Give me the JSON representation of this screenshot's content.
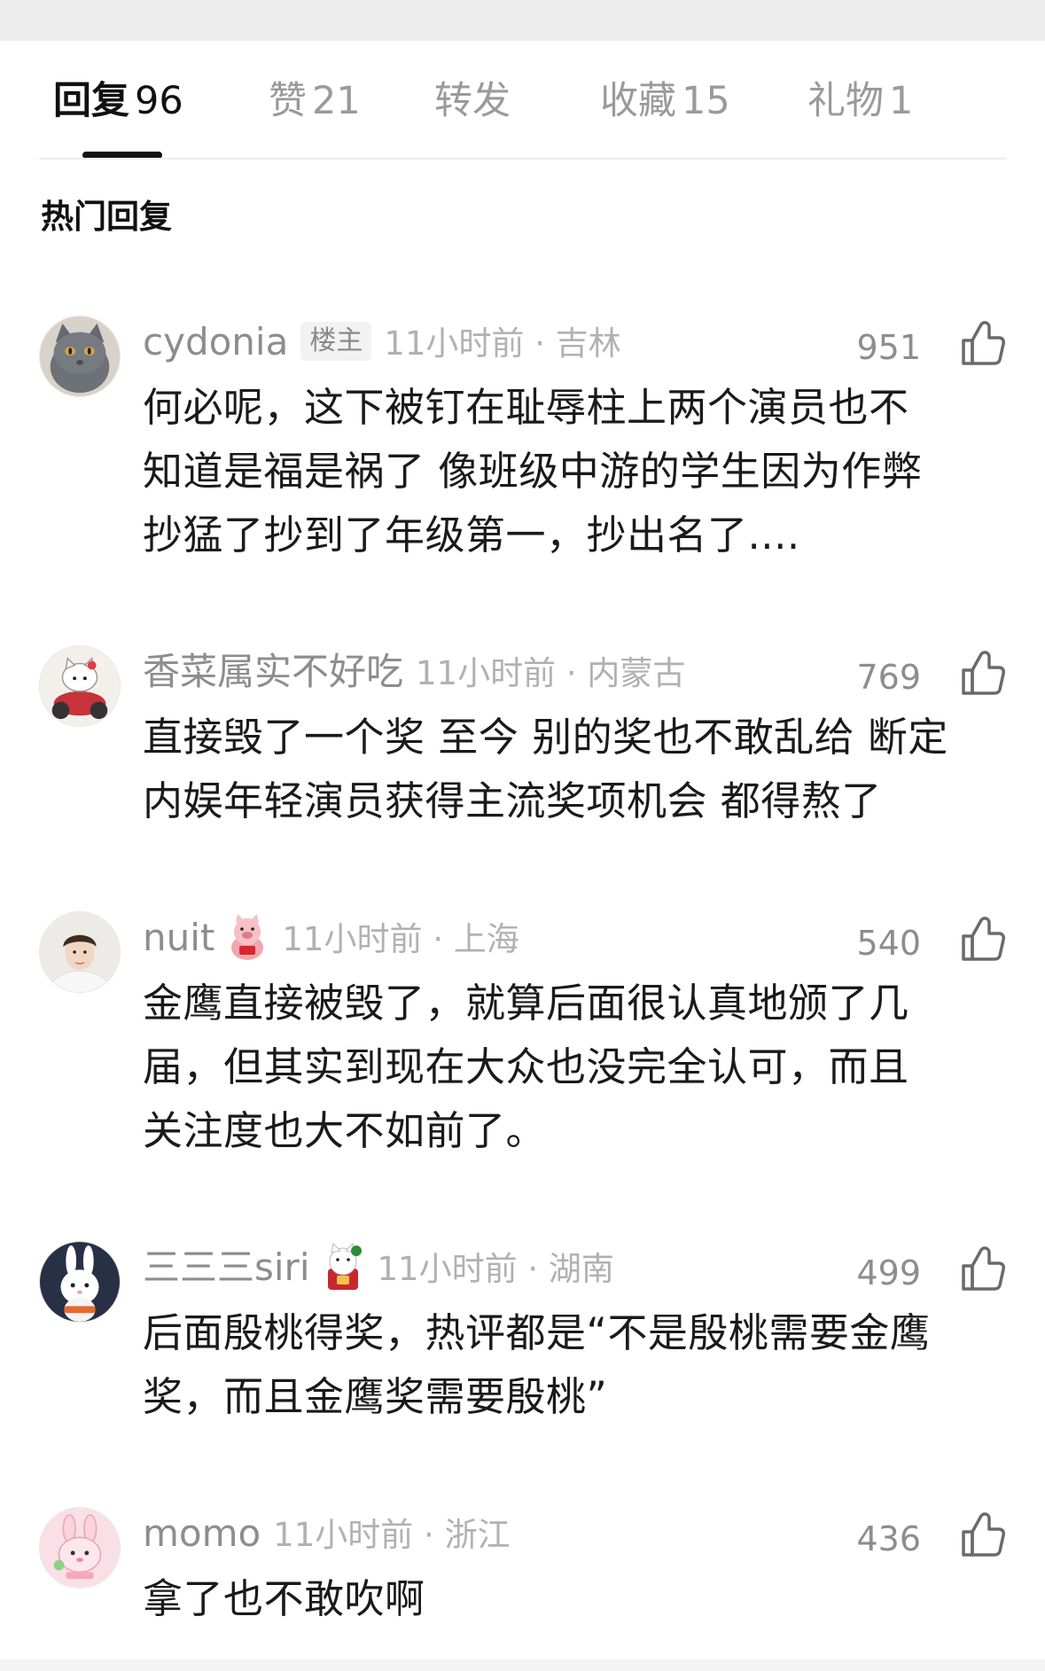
{
  "tabs": [
    {
      "label": "回复",
      "count": "96",
      "active": true
    },
    {
      "label": "赞",
      "count": "21",
      "active": false
    },
    {
      "label": "转发",
      "count": "",
      "active": false
    },
    {
      "label": "收藏",
      "count": "15",
      "active": false
    },
    {
      "label": "礼物",
      "count": "1",
      "active": false
    }
  ],
  "section_title": "热门回复",
  "comments": [
    {
      "username": "cydonia",
      "badge": "楼主",
      "time": "11小时前",
      "location": "吉林",
      "timeloc": "11小时前 · 吉林",
      "likes": "951",
      "lines": [
        "何必呢，这下被钉在耻辱柱上两个演员也不",
        "知道是福是祸了 像班级中游的学生因为作弊",
        "抄猛了抄到了年级第一，抄出名了...."
      ],
      "avatar_icon": "gray-cat-avatar"
    },
    {
      "username": "香菜属实不好吃",
      "badge": "",
      "time": "11小时前",
      "location": "内蒙古",
      "timeloc": "11小时前 · 内蒙古",
      "likes": "769",
      "lines": [
        "直接毁了一个奖 至今 别的奖也不敢乱给 断定",
        "内娱年轻演员获得主流奖项机会 都得熬了"
      ],
      "avatar_icon": "hello-kitty-motorbike-avatar"
    },
    {
      "username": "nuit",
      "badge": "",
      "time": "11小时前",
      "location": "上海",
      "timeloc": "11小时前 · 上海",
      "likes": "540",
      "lines": [
        "金鹰直接被毁了，就算后面很认真地颁了几",
        "届，但其实到现在大众也没完全认可，而且",
        "关注度也大不如前了。"
      ],
      "avatar_icon": "man-portrait-avatar"
    },
    {
      "username": "三三三siri",
      "badge": "",
      "time": "11小时前",
      "location": "湖南",
      "timeloc": "11小时前 · 湖南",
      "likes": "499",
      "lines": [
        "后面殷桃得奖，热评都是“不是殷桃需要金鹰",
        "奖，而且金鹰奖需要殷桃”"
      ],
      "avatar_icon": "white-rabbit-avatar"
    },
    {
      "username": "momo",
      "badge": "",
      "time": "11小时前",
      "location": "浙江",
      "timeloc": "11小时前 · 浙江",
      "likes": "436",
      "lines": [
        "拿了也不敢吹啊"
      ],
      "avatar_icon": "pink-rabbit-avatar"
    }
  ],
  "icons": {
    "like": "thumbs-up-icon",
    "nuit_badge": "pig-figure-icon",
    "siri_badge": "fortune-cat-icon"
  },
  "colors": {
    "primary_text": "#1a1a1a",
    "secondary_text": "#8d8d8d",
    "tertiary_text": "#b1b1b1",
    "active_tab": "#111111",
    "inactive_tab": "#9a9a9a"
  }
}
